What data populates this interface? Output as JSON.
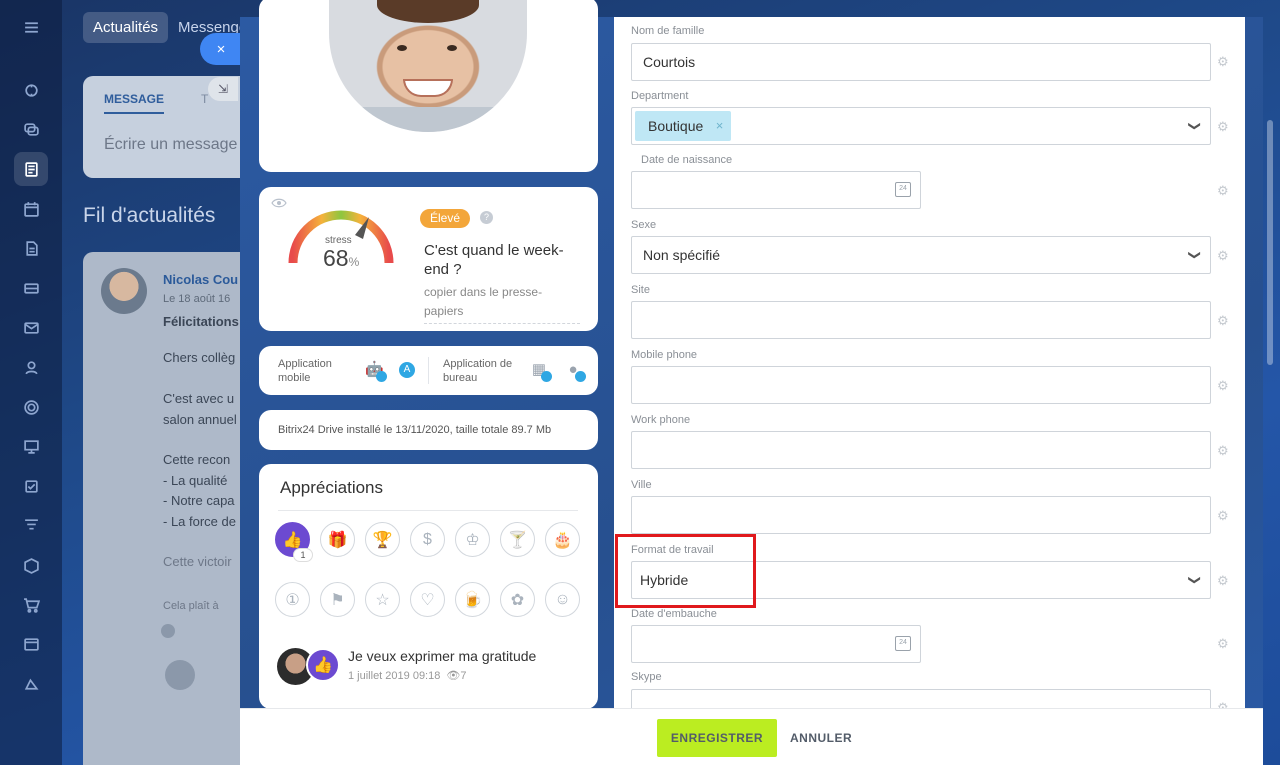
{
  "bg": {
    "tabs": [
      "Actualités",
      "Messenger"
    ],
    "composer": {
      "tab_message": "MESSAGE",
      "tab_t": "T",
      "placeholder": "Écrire un message"
    },
    "feed_title": "Fil d'actualités",
    "post": {
      "author": "Nicolas Cou",
      "date": "Le 18 août 16",
      "headline": "Félicitations",
      "lines": [
        "Chers collèg",
        "C'est avec u",
        "salon annuel",
        "Cette recon",
        "- La qualité",
        "- Notre capa",
        "- La force de",
        "Cette victoir",
        "Cela plaît à"
      ]
    }
  },
  "overlay": {
    "close_icon": "×",
    "collapse_icon": "⇲"
  },
  "profile": {
    "stress": {
      "label": "stress",
      "value": "68",
      "unit": "%",
      "badge": "Élevé",
      "help": "?",
      "quote": "C'est quand le week-end ?",
      "copy_link": "copier dans le presse-papiers"
    },
    "apps": {
      "mobile": "Application mobile",
      "desktop": "Application de bureau"
    },
    "drive": "Bitrix24 Drive installé le 13/11/2020, taille totale 89.7 Mb",
    "appreciations": {
      "title": "Appréciations",
      "count": "1",
      "last": {
        "text": "Je veux exprimer ma gratitude",
        "date": "1 juillet 2019 09:18",
        "views": "7"
      }
    }
  },
  "form": {
    "fields": [
      {
        "label": "Nom de famille",
        "value": "Courtois",
        "type": "text"
      },
      {
        "label": "Department",
        "value": "Boutique",
        "type": "tag-select"
      },
      {
        "label": "Date de naissance",
        "value": "",
        "type": "date"
      },
      {
        "label": "Sexe",
        "value": "Non spécifié",
        "type": "select"
      },
      {
        "label": "Site",
        "value": "",
        "type": "text"
      },
      {
        "label": "Mobile phone",
        "value": "",
        "type": "text"
      },
      {
        "label": "Work phone",
        "value": "",
        "type": "text"
      },
      {
        "label": "Ville",
        "value": "",
        "type": "text"
      },
      {
        "label": "Format de travail",
        "value": "Hybride",
        "type": "select"
      },
      {
        "label": "Date d'embauche",
        "value": "",
        "type": "date"
      },
      {
        "label": "Skype",
        "value": "",
        "type": "text"
      }
    ]
  },
  "footer": {
    "save": "ENREGISTRER",
    "cancel": "ANNULER"
  },
  "colors": {
    "accent": "#bbed21",
    "highlight": "#e0191d",
    "tag": "#bfe7f5",
    "appreciation": "#6c4ad1"
  }
}
